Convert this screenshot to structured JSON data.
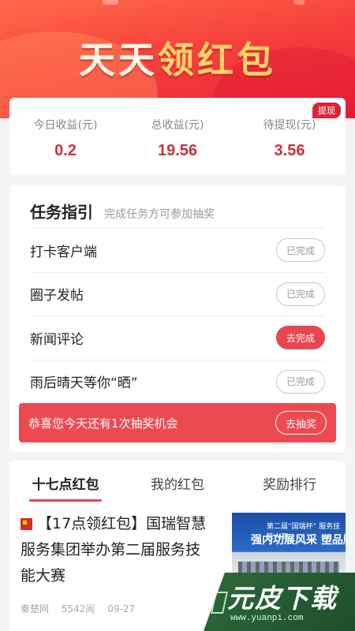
{
  "banner": {
    "title_part1": "天天",
    "title_part2": "领红包"
  },
  "earnings": {
    "withdraw_label": "提现",
    "items": [
      {
        "label": "今日收益(元)",
        "value": "0.2"
      },
      {
        "label": "总收益(元)",
        "value": "19.56"
      },
      {
        "label": "待提现(元)",
        "value": "3.56"
      }
    ]
  },
  "tasks": {
    "title": "任务指引",
    "subtitle": "完成任务方可参加抽奖",
    "items": [
      {
        "name": "打卡客户端",
        "status": "已完成"
      },
      {
        "name": "圈子发帖",
        "status": "已完成"
      },
      {
        "name": "新闻评论",
        "status": "去完成"
      },
      {
        "name": "雨后晴天等你“晒”",
        "status": "已完成"
      }
    ],
    "lottery_text": "恭喜您今天还有1次抽奖机会",
    "lottery_button": "去抽奖"
  },
  "tabs": [
    "十七点红包",
    "我的红包",
    "奖励排行"
  ],
  "news": {
    "headline": "【17点领红包】国瑞智慧服务集团举办第二届服务技能大赛",
    "source": "秦楚网",
    "reads": "5542阅",
    "date": "09-27",
    "thumb_line1": "第二届“国瑞杯” 服务技能大赛",
    "thumb_line2": "强内功展风采  塑品牌献"
  },
  "watermark": {
    "text": "元皮下载",
    "url": "www.yuanpi.com"
  },
  "colors": {
    "primary_red": "#e8464f",
    "value_red": "#c8323a",
    "banner_red": "#f6413c"
  }
}
